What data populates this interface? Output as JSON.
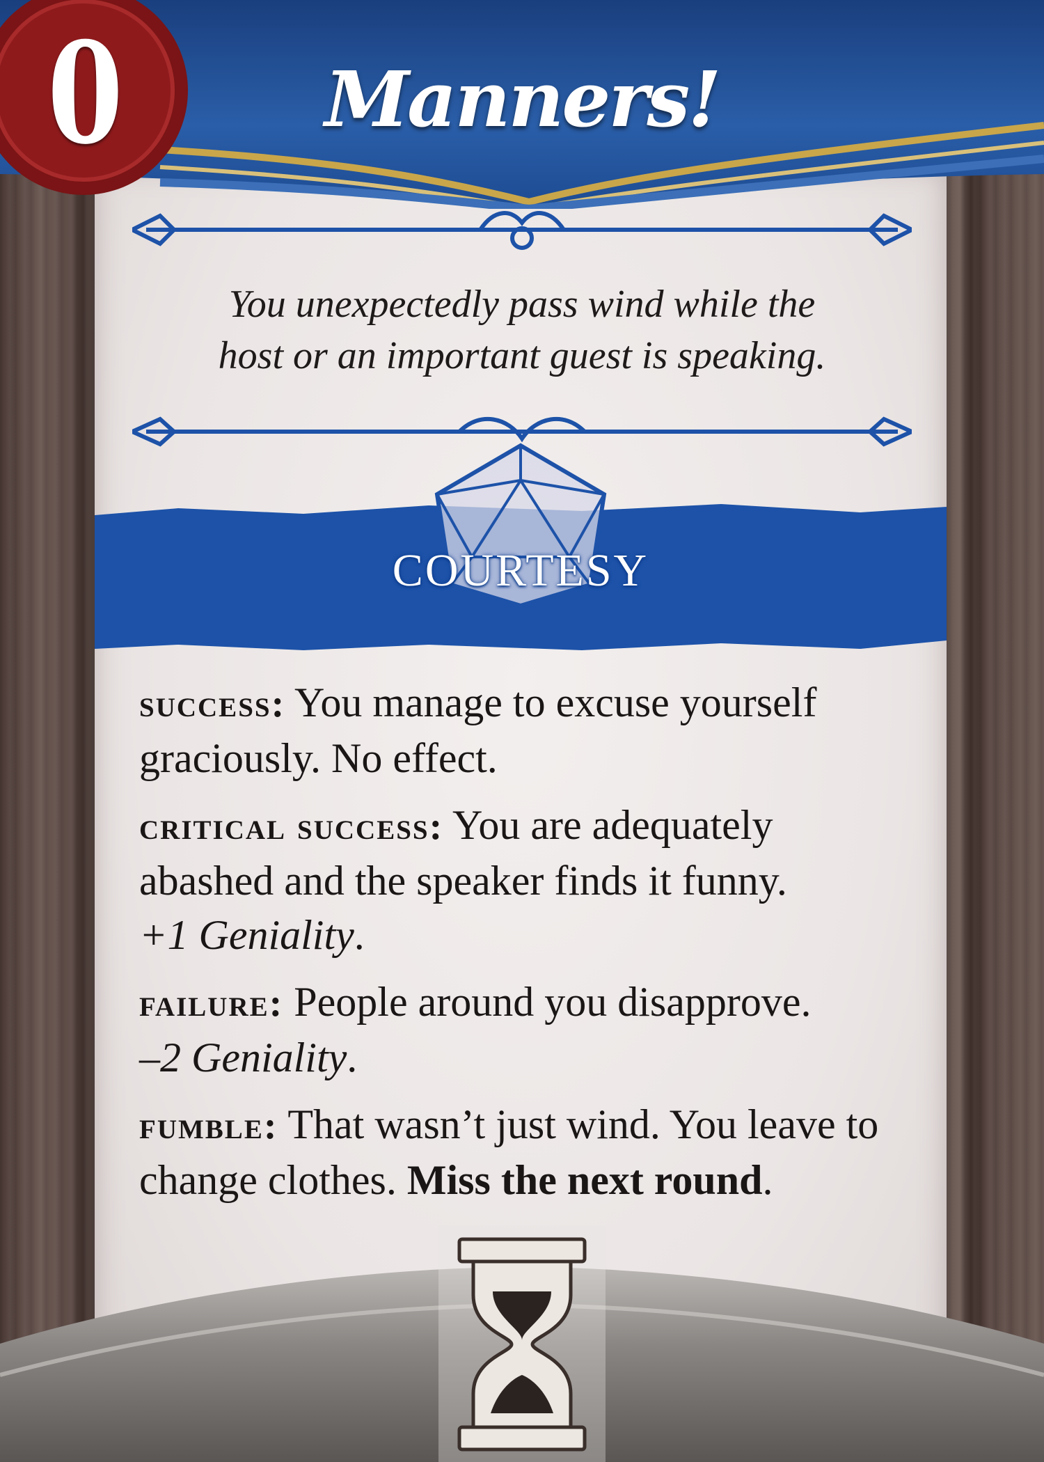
{
  "card": {
    "cost": "0",
    "title": "Manners!",
    "flavor_line1": "You unexpectedly pass wind while the",
    "flavor_line2": "host or an important guest is speaking.",
    "skill": "COURTESY",
    "outcomes": {
      "success_label": "success:",
      "success_text": " You manage to excuse yourself graciously. No effect.",
      "critical_label": "critical success:",
      "critical_text": " You are adequately abashed and the speaker finds it funny.",
      "critical_mod": "+1 Geniality",
      "failure_label": "failure:",
      "failure_text": " People around you disapprove.",
      "failure_mod": "–2 Geniality",
      "fumble_label": "fumble:",
      "fumble_text": " That wasn’t just wind. You leave to change clothes. ",
      "fumble_bold": "Miss the next round"
    },
    "period": "."
  },
  "colors": {
    "banner_blue": "#1f4e96",
    "seal_red": "#8e1a1c",
    "skill_blue": "#1d52a8",
    "gold_trim": "#c9a64a"
  },
  "icons": {
    "die": "d20-icon",
    "timing": "hourglass-icon"
  }
}
